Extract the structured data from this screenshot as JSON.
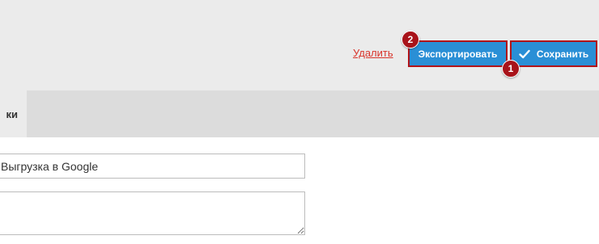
{
  "toolbar": {
    "delete_label": "Удалить",
    "export_label": "Экспортировать",
    "save_label": "Сохранить",
    "save_icon": "check-icon"
  },
  "markers": {
    "first": "1",
    "second": "2"
  },
  "tabs": {
    "active_label": "ки"
  },
  "form": {
    "name_value": "Выгрузка в Google",
    "description_value": ""
  },
  "colors": {
    "accent": "#2a8fd6",
    "marker": "#a8131a",
    "link": "#d9342b"
  }
}
